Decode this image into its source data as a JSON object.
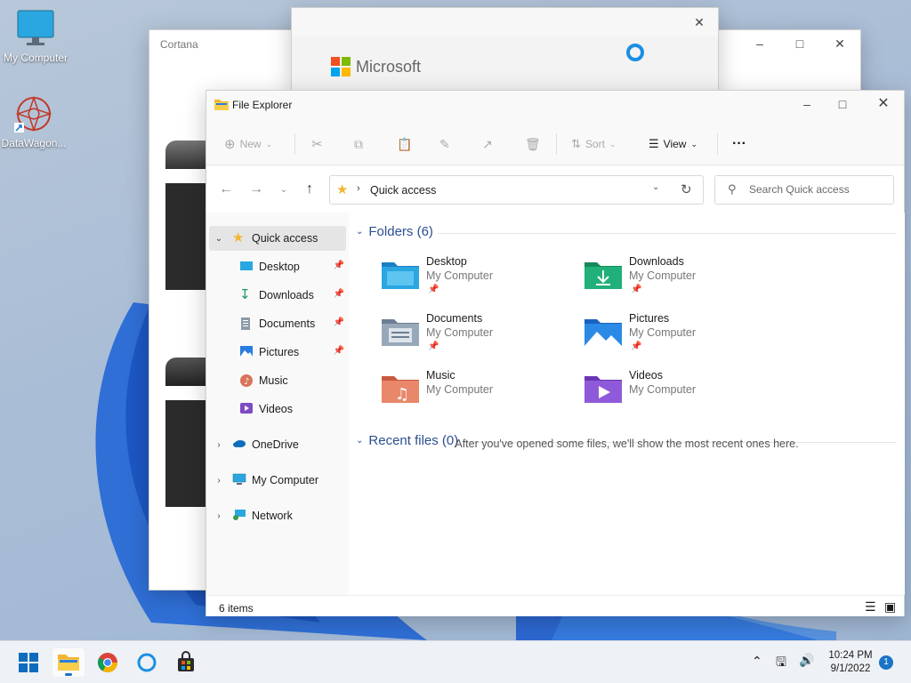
{
  "desktop": {
    "icons": [
      {
        "label": "My Computer"
      },
      {
        "label": "DataWagon..."
      }
    ]
  },
  "cortana_window": {
    "title": "Cortana"
  },
  "splash_window": {
    "brand": "Microsoft"
  },
  "explorer": {
    "title": "File Explorer",
    "toolbar": {
      "new_label": "New",
      "sort_label": "Sort",
      "view_label": "View",
      "more_label": "···"
    },
    "address": {
      "path_label": "Quick access"
    },
    "search": {
      "placeholder": "Search Quick access"
    },
    "sidebar": {
      "quick_access": "Quick access",
      "items": [
        {
          "label": "Desktop",
          "pinned": true
        },
        {
          "label": "Downloads",
          "pinned": true
        },
        {
          "label": "Documents",
          "pinned": true
        },
        {
          "label": "Pictures",
          "pinned": true
        },
        {
          "label": "Music",
          "pinned": false
        },
        {
          "label": "Videos",
          "pinned": false
        }
      ],
      "roots": [
        {
          "label": "OneDrive"
        },
        {
          "label": "My Computer"
        },
        {
          "label": "Network"
        }
      ]
    },
    "folders_header": "Folders (6)",
    "folders": [
      {
        "name": "Desktop",
        "location": "My Computer",
        "pinned": true
      },
      {
        "name": "Downloads",
        "location": "My Computer",
        "pinned": true
      },
      {
        "name": "Documents",
        "location": "My Computer",
        "pinned": true
      },
      {
        "name": "Pictures",
        "location": "My Computer",
        "pinned": true
      },
      {
        "name": "Music",
        "location": "My Computer",
        "pinned": false
      },
      {
        "name": "Videos",
        "location": "My Computer",
        "pinned": false
      }
    ],
    "recent_header": "Recent files (0)",
    "recent_empty": "After you've opened some files, we'll show the most recent ones here.",
    "status": {
      "item_count": "6 items"
    }
  },
  "taskbar": {
    "time": "10:24 PM",
    "date": "9/1/2022",
    "notification_count": "1"
  },
  "colors": {
    "accent": "#1a73c5",
    "section_header": "#2a4f8f"
  }
}
